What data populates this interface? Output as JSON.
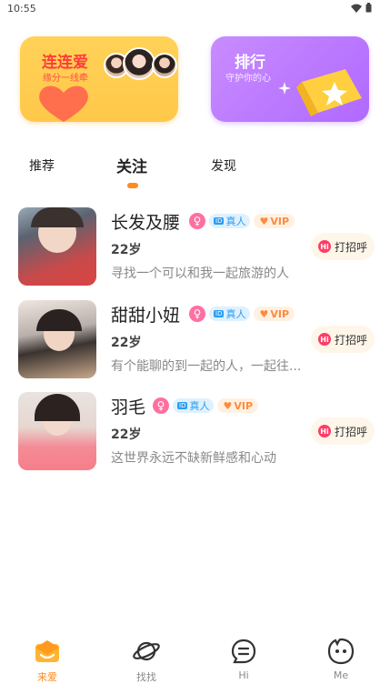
{
  "status": {
    "time": "10:55"
  },
  "banners": {
    "left": {
      "title": "连连爱",
      "subtitle": "缘分一线牵"
    },
    "right": {
      "title": "排行",
      "subtitle": "守护你的心"
    }
  },
  "tabs": [
    {
      "label": "推荐"
    },
    {
      "label": "关注"
    },
    {
      "label": "发现"
    }
  ],
  "users": [
    {
      "name": "长发及腰",
      "age": "22岁",
      "bio": "寻找一个可以和我一起旅游的人",
      "real_label": "真人",
      "vip_label": "VIP",
      "greet": "打招呼"
    },
    {
      "name": "甜甜小妞",
      "age": "22岁",
      "bio": "有个能聊的到一起的人，一起往...",
      "real_label": "真人",
      "vip_label": "VIP",
      "greet": "打招呼"
    },
    {
      "name": "羽毛",
      "age": "22岁",
      "bio": "这世界永远不缺新鲜感和心动",
      "real_label": "真人",
      "vip_label": "VIP",
      "greet": "打招呼"
    }
  ],
  "nav": [
    {
      "label": "来爱",
      "icon": "mail-heart-icon"
    },
    {
      "label": "找找",
      "icon": "planet-icon"
    },
    {
      "label": "Hi",
      "icon": "chat-bubble-icon"
    },
    {
      "label": "Me",
      "icon": "face-icon"
    }
  ],
  "colors": {
    "accent": "#ff8a1e",
    "female": "#ff6fa1",
    "real": "#2a9df4",
    "vip": "#ff8a3d"
  }
}
